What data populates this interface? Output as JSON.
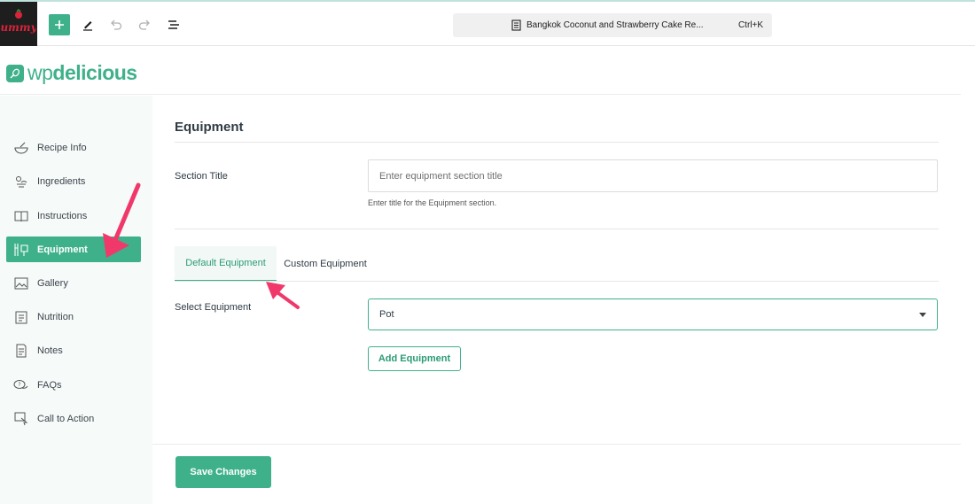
{
  "toolbar": {
    "site_logo_text": "ummy",
    "document_title": "Bangkok Coconut and Strawberry Cake Re...",
    "shortcut": "Ctrl+K"
  },
  "brand": {
    "prefix": "wp",
    "suffix": "delicious"
  },
  "sidebar": {
    "items": [
      {
        "label": "Recipe Info",
        "icon": "bowl-icon"
      },
      {
        "label": "Ingredients",
        "icon": "ingredients-icon"
      },
      {
        "label": "Instructions",
        "icon": "book-icon"
      },
      {
        "label": "Equipment",
        "icon": "utensils-icon",
        "active": true
      },
      {
        "label": "Gallery",
        "icon": "image-icon"
      },
      {
        "label": "Nutrition",
        "icon": "nutrition-icon"
      },
      {
        "label": "Notes",
        "icon": "notes-icon"
      },
      {
        "label": "FAQs",
        "icon": "faq-icon"
      },
      {
        "label": "Call to Action",
        "icon": "cursor-icon"
      }
    ]
  },
  "main": {
    "heading": "Equipment",
    "section_title_label": "Section Title",
    "section_title_placeholder": "Enter equipment section title",
    "section_title_value": "",
    "section_title_help": "Enter title for the Equipment section.",
    "tabs": [
      {
        "label": "Default Equipment",
        "active": true
      },
      {
        "label": "Custom Equipment",
        "active": false
      }
    ],
    "select_label": "Select Equipment",
    "select_value": "Pot",
    "add_button": "Add Equipment"
  },
  "footer": {
    "save_button": "Save Changes"
  },
  "colors": {
    "accent": "#3fb18a",
    "annotation_arrow": "#f0386b",
    "dark_logo": "#1e1e1e"
  }
}
